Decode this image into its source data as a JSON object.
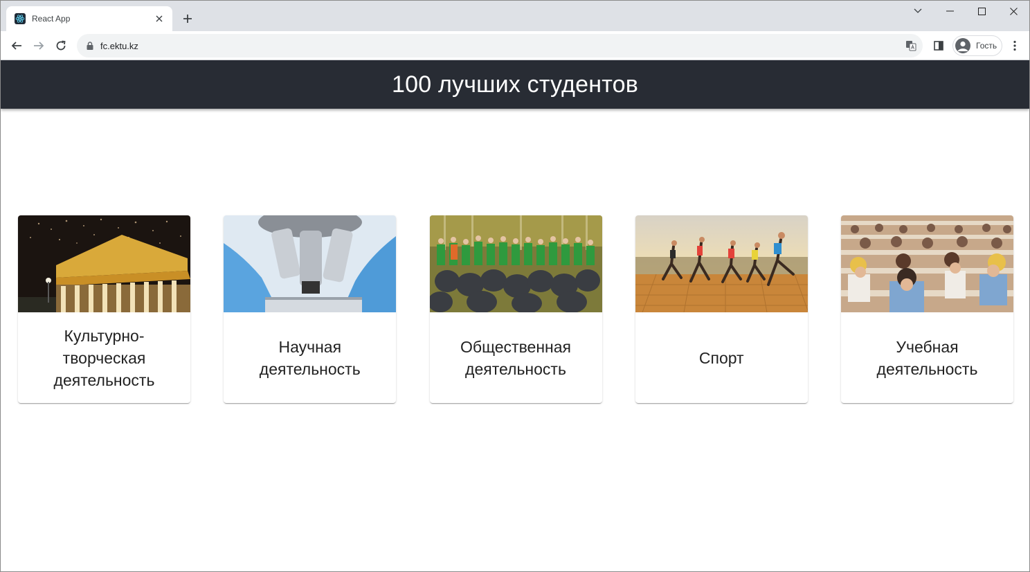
{
  "browser": {
    "tab_title": "React App",
    "url": "fc.ektu.kz",
    "profile_label": "Гость"
  },
  "header": {
    "title": "100 лучших студентов"
  },
  "cards": [
    {
      "title": "Культурно-творческая деятельность",
      "image_icon": "night-building-fireworks-photo"
    },
    {
      "title": "Научная деятельность",
      "image_icon": "microscope-photo"
    },
    {
      "title": "Общественная деятельность",
      "image_icon": "volunteers-group-photo"
    },
    {
      "title": "Спорт",
      "image_icon": "runners-photo"
    },
    {
      "title": "Учебная деятельность",
      "image_icon": "students-lecture-hall-photo"
    }
  ],
  "colors": {
    "header_bg": "#282c34",
    "tabstrip_bg": "#dee1e6",
    "omnibox_bg": "#f1f3f4"
  }
}
